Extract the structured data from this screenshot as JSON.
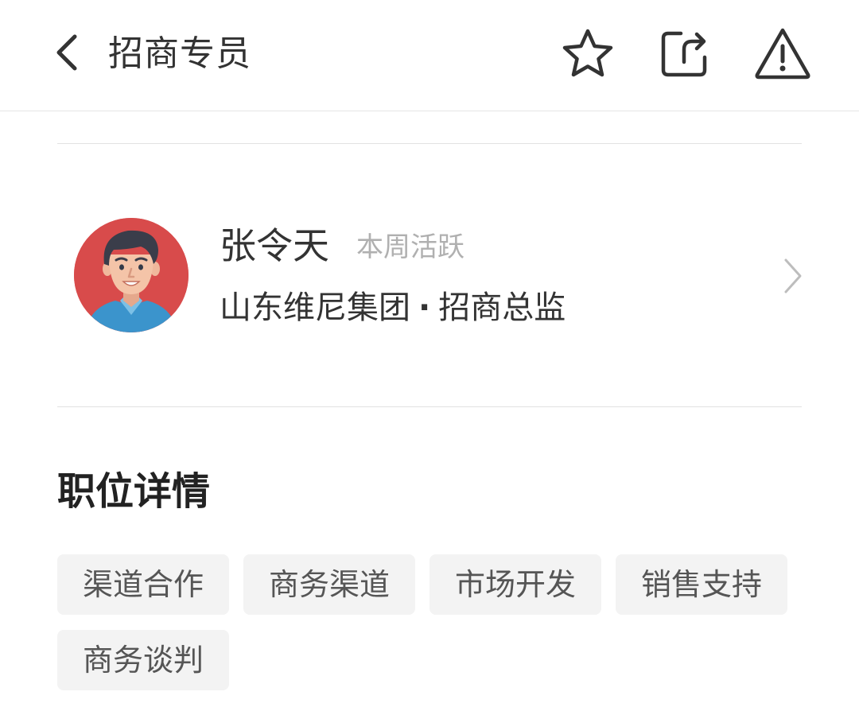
{
  "header": {
    "title": "招商专员",
    "icons": {
      "back": "chevron-left-icon",
      "favorite": "star-icon",
      "share": "share-icon",
      "report": "warning-icon"
    }
  },
  "profile": {
    "name": "张令天",
    "status": "本周活跃",
    "company": "山东维尼集团",
    "separator": "·",
    "position": "招商总监",
    "avatar_bg": "#d84b4b"
  },
  "job_detail": {
    "section_title": "职位详情",
    "tags": [
      "渠道合作",
      "商务渠道",
      "市场开发",
      "销售支持",
      "商务谈判"
    ]
  },
  "colors": {
    "text_primary": "#333333",
    "text_muted": "#b0b0b0",
    "tag_bg": "#f3f3f3",
    "divider": "#e2e2e2"
  }
}
